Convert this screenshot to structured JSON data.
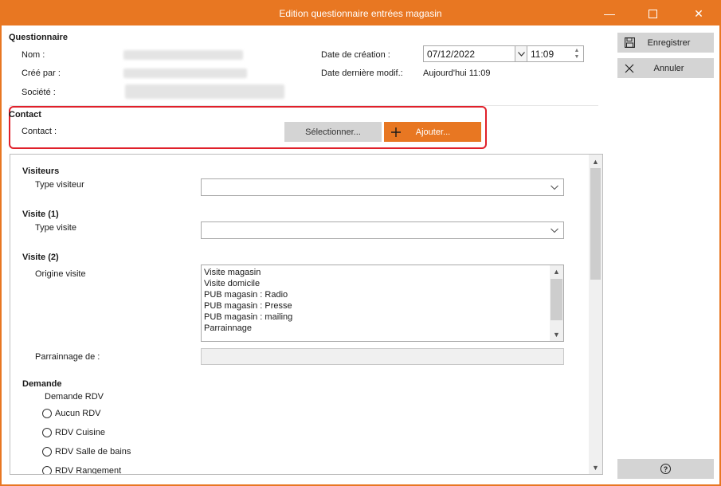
{
  "window": {
    "title": "Edition questionnaire entrées magasin",
    "minimize_symbol": "—",
    "close_symbol": "✕"
  },
  "questionnaire": {
    "section_title": "Questionnaire",
    "nom_label": "Nom :",
    "cree_par_label": "Créé par :",
    "societe_label": "Société :",
    "date_creation_label": "Date de création :",
    "date_creation_value": "07/12/2022",
    "time_value": "11:09",
    "date_modif_label": "Date dernière modif.:",
    "date_modif_value": "Aujourd'hui 11:09"
  },
  "contact": {
    "section_title": "Contact",
    "contact_label": "Contact :",
    "select_button": "Sélectionner...",
    "add_button": "Ajouter...",
    "add_icon": "plus-icon"
  },
  "form": {
    "visiteurs_title": "Visiteurs",
    "type_visiteur_label": "Type visiteur",
    "visite1_title": "Visite (1)",
    "type_visite_label": "Type visite",
    "visite2_title": "Visite (2)",
    "origine_visite_label": "Origine visite",
    "origine_options": [
      "Visite magasin",
      "Visite domicile",
      "PUB magasin : Radio",
      "PUB magasin : Presse",
      "PUB magasin : mailing",
      "Parrainnage"
    ],
    "parrainnage_label": "Parrainnage de :",
    "demande_title": "Demande",
    "demande_rdv_label": "Demande RDV",
    "rdv_options": [
      "Aucun RDV",
      "RDV Cuisine",
      "RDV Salle de bains",
      "RDV Rangement"
    ]
  },
  "side": {
    "save_label": "Enregistrer",
    "save_icon": "floppy-disk-icon",
    "cancel_label": "Annuler",
    "cancel_icon": "close-icon",
    "help_icon": "question-circle-icon",
    "help_symbol": "?"
  },
  "colors": {
    "accent": "#E87722",
    "highlight_frame": "#e0202a",
    "button_grey": "#d4d4d4"
  }
}
